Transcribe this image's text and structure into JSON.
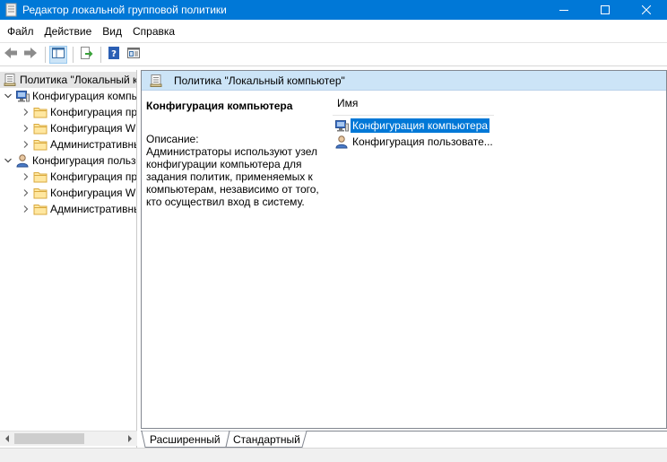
{
  "window": {
    "title": "Редактор локальной групповой политики",
    "accent": "#0078d7"
  },
  "menu": {
    "items": [
      "Файл",
      "Действие",
      "Вид",
      "Справка"
    ]
  },
  "toolbar": {
    "buttons": [
      "back-arrow-icon",
      "forward-arrow-icon",
      "show-hide-tree-icon",
      "export-list-icon",
      "help-icon",
      "properties-icon"
    ]
  },
  "tree": {
    "root": "Политика \"Локальный компьютер\"",
    "computer_config": "Конфигурация компьютера",
    "user_config": "Конфигурация пользователя",
    "children_computer": [
      "Конфигурация программ",
      "Конфигурация Windows",
      "Административные шаблоны"
    ],
    "children_user": [
      "Конфигурация программ",
      "Конфигурация Windows",
      "Административные шаблоны"
    ]
  },
  "right": {
    "header": "Политика \"Локальный компьютер\"",
    "heading": "Конфигурация компьютера",
    "desc_label": "Описание:",
    "desc_text": "Администраторы используют узел конфигурации компьютера для задания политик, применяемых к компьютерам, независимо от того, кто осуществил вход в систему.",
    "column": "Имя",
    "items": [
      "Конфигурация компьютера",
      "Конфигурация пользовате..."
    ]
  },
  "tabs": {
    "extended": "Расширенный",
    "standard": "Стандартный"
  }
}
